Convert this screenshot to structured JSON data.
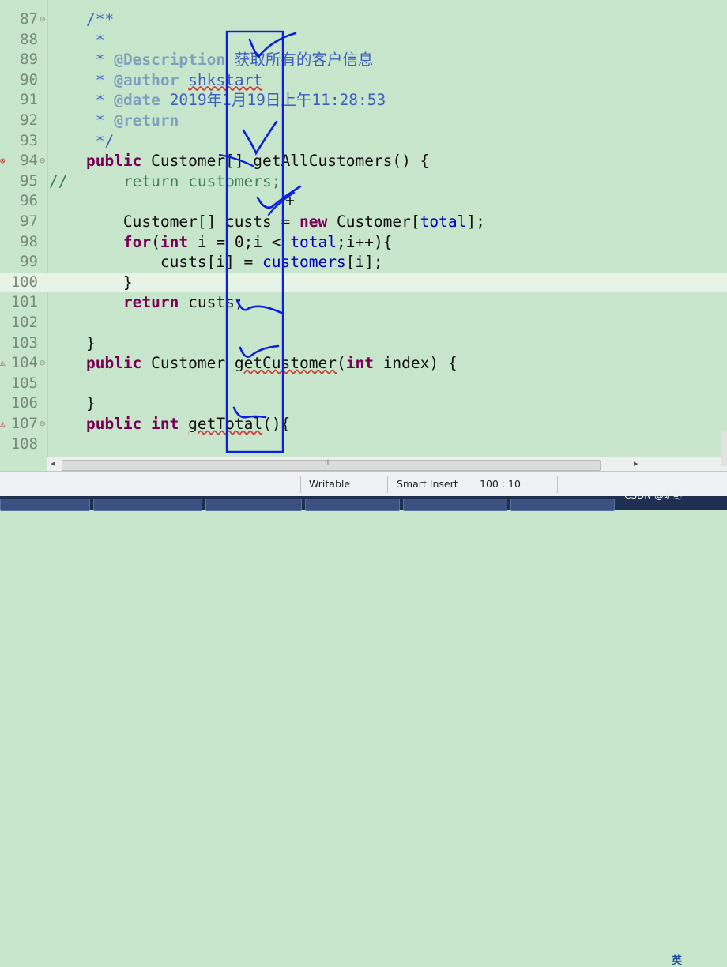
{
  "editor": {
    "lines": [
      {
        "n": "87",
        "fold": "⊖"
      },
      {
        "n": "88"
      },
      {
        "n": "89"
      },
      {
        "n": "90"
      },
      {
        "n": "91"
      },
      {
        "n": "92"
      },
      {
        "n": "93"
      },
      {
        "n": "94",
        "fold": "⊖"
      },
      {
        "n": "95"
      },
      {
        "n": "96"
      },
      {
        "n": "97"
      },
      {
        "n": "98"
      },
      {
        "n": "99"
      },
      {
        "n": "100"
      },
      {
        "n": "101"
      },
      {
        "n": "102"
      },
      {
        "n": "103"
      },
      {
        "n": "104",
        "fold": "⊖"
      },
      {
        "n": "105"
      },
      {
        "n": "106"
      },
      {
        "n": "107",
        "fold": "⊖"
      },
      {
        "n": "108"
      }
    ],
    "code": {
      "l87": "/**",
      "l88": " *",
      "l89_tag": "@Description",
      "l89_text": "获取所有的客户信息",
      "l90_tag": "@author",
      "l90_text": "shkstart",
      "l91_tag": "@date",
      "l91_text": "2019年1月19日上午11:28:53",
      "l92_tag": "@return",
      "l93": " */",
      "l94_kw": "public",
      "l94_rest": "Customer[] getAllCustomers() {",
      "l95_comment": "//",
      "l95_body": "return customers;",
      "l97_a": "Customer[] custs = ",
      "l97_new": "new",
      "l97_b": " Customer[",
      "l97_field": "total",
      "l97_c": "];",
      "l98_for": "for",
      "l98_a": "(",
      "l98_int": "int",
      "l98_b": " i = 0;i < ",
      "l98_field": "total",
      "l98_c": ";i++){",
      "l99_a": "custs[i] = ",
      "l99_field": "customers",
      "l99_b": "[i];",
      "l100": "}",
      "l101_kw": "return",
      "l101_rest": " custs;",
      "l103": "}",
      "l104_kw": "public",
      "l104_a": " Customer ",
      "l104_m": "getCustomer",
      "l104_b": "(",
      "l104_int": "int",
      "l104_c": " index) {",
      "l106": "}",
      "l107_kw1": "public",
      "l107_kw2": "int",
      "l107_m": "getTotal",
      "l107_rest": "(){"
    }
  },
  "scrollbar": {
    "thumb_label": "III"
  },
  "statusbar": {
    "writable": "Writable",
    "insert_mode": "Smart Insert",
    "cursor_pos": "100 : 10"
  },
  "watermark": "CSDN @旷野 ",
  "ime": "英",
  "colors": {
    "editor_bg": "#c7e6cc",
    "keyword": "#7a0055",
    "javadoc": "#3f5fbf",
    "field": "#0000c0",
    "annotation_pen": "#0b1fe0"
  }
}
